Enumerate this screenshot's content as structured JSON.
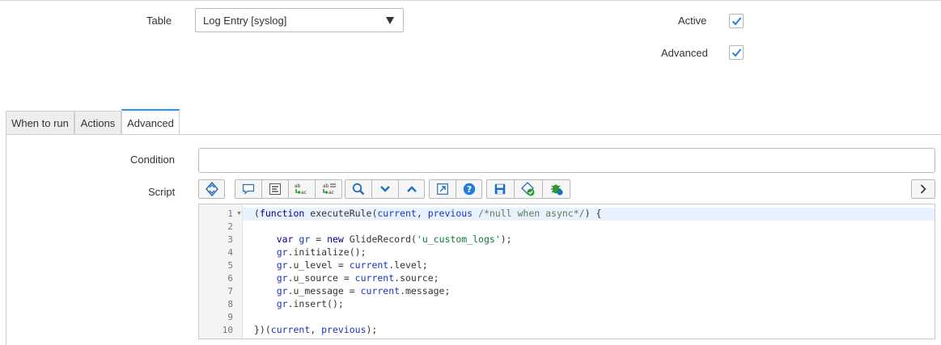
{
  "form": {
    "table_label": "Table",
    "table_value": "Log Entry [syslog]",
    "active_label": "Active",
    "active_checked": true,
    "advanced_label": "Advanced",
    "advanced_checked": true
  },
  "tabs": [
    {
      "label": "When to run",
      "active": false
    },
    {
      "label": "Actions",
      "active": false
    },
    {
      "label": "Advanced",
      "active": true
    }
  ],
  "advanced": {
    "condition_label": "Condition",
    "condition_value": "",
    "script_label": "Script"
  },
  "toolbar": {
    "icons": [
      "toggle-syntax-icon",
      "comment-icon",
      "format-code-icon",
      "replace-icon",
      "replace-all-icon",
      "search-icon",
      "fold-down-icon",
      "fold-up-icon",
      "fullscreen-icon",
      "help-icon",
      "save-icon",
      "syntax-check-icon",
      "debug-icon",
      "chevron-right-icon"
    ]
  },
  "script": {
    "lines": [
      {
        "n": "1",
        "text": "(function executeRule(current, previous /*null when async*/) {"
      },
      {
        "n": "2",
        "text": ""
      },
      {
        "n": "3",
        "text": "    var gr = new GlideRecord('u_custom_logs');"
      },
      {
        "n": "4",
        "text": "    gr.initialize();"
      },
      {
        "n": "5",
        "text": "    gr.u_level = current.level;"
      },
      {
        "n": "6",
        "text": "    gr.u_source = current.source;"
      },
      {
        "n": "7",
        "text": "    gr.u_message = current.message;"
      },
      {
        "n": "8",
        "text": "    gr.insert();"
      },
      {
        "n": "9",
        "text": ""
      },
      {
        "n": "10",
        "text": "})(current, previous);"
      }
    ]
  },
  "colors": {
    "accent": "#278efc",
    "check": "#2a7de1"
  }
}
